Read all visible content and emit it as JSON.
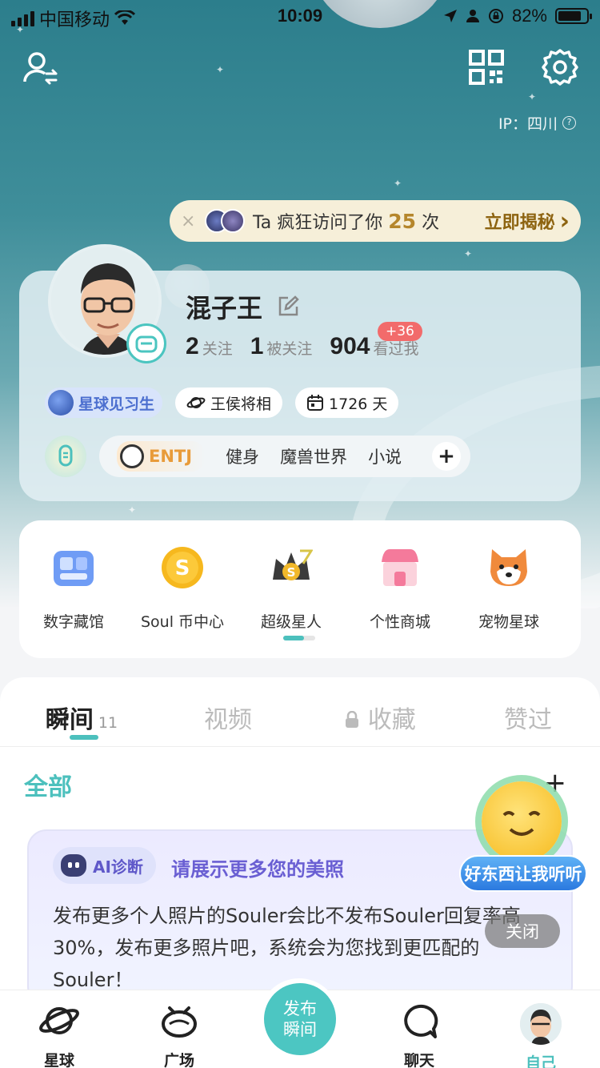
{
  "status": {
    "carrier": "中国移动",
    "time": "10:09",
    "battery": "82%",
    "battery_level": 0.82
  },
  "header": {
    "ip_label": "IP：四川",
    "ip_help_icon": "?"
  },
  "visitor_banner": {
    "close_glyph": "×",
    "text_before": "Ta 疯狂访问了你",
    "count": "25",
    "text_after": "次",
    "cta": "立即揭秘",
    "cta_arrow": "›"
  },
  "profile": {
    "name": "混子王",
    "following_count": "2",
    "following_label": "关注",
    "followers_count": "1",
    "followers_label": "被关注",
    "views_count": "904",
    "views_label": "看过我",
    "views_new": "+36",
    "tags": [
      "星球见习生",
      "王侯将相",
      "1726 天"
    ],
    "mbti": "ENTJ",
    "interests": [
      "健身",
      "魔兽世界",
      "小说"
    ],
    "add_interest": "+"
  },
  "services": [
    {
      "label": "数字藏馆",
      "icon": "museum-icon",
      "color": "#6f9cf5"
    },
    {
      "label": "Soul 币中心",
      "icon": "coin-icon",
      "color": "#f6b81e"
    },
    {
      "label": "超级星人",
      "icon": "crown-icon",
      "color": "#3b3b3b"
    },
    {
      "label": "个性商城",
      "icon": "shop-icon",
      "color": "#f47a9b"
    },
    {
      "label": "宠物星球",
      "icon": "shiba-icon",
      "color": "#f08a3c"
    }
  ],
  "content_tabs": [
    {
      "label": "瞬间",
      "count": "11"
    },
    {
      "label": "视频"
    },
    {
      "label": "收藏"
    },
    {
      "label": "赞过"
    }
  ],
  "filter": {
    "label": "全部",
    "add": "+"
  },
  "ai_card": {
    "tag": "AI诊断",
    "title": "请展示更多您的美照",
    "body": "发布更多个人照片的Souler会比不发布Souler回复率高30%，发布更多照片吧，系统会为您找到更匹配的Souler！"
  },
  "float": {
    "banner": "好东西让我听听",
    "close": "关闭"
  },
  "tabbar": {
    "items": [
      "星球",
      "广场",
      "聊天",
      "自己"
    ],
    "publish": "发布瞬间"
  },
  "colors": {
    "accent": "#4cc0bd",
    "badge_red": "#f26b6b",
    "gold": "#b5862b"
  }
}
